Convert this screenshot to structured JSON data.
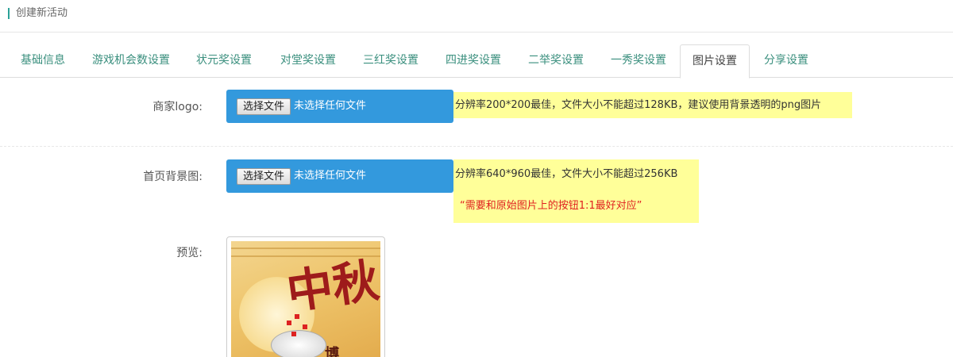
{
  "header": {
    "title": "创建新活动"
  },
  "tabs": [
    {
      "label": "基础信息"
    },
    {
      "label": "游戏机会数设置"
    },
    {
      "label": "状元奖设置"
    },
    {
      "label": "对堂奖设置"
    },
    {
      "label": "三红奖设置"
    },
    {
      "label": "四进奖设置"
    },
    {
      "label": "二举奖设置"
    },
    {
      "label": "一秀奖设置"
    },
    {
      "label": "图片设置"
    },
    {
      "label": "分享设置"
    }
  ],
  "active_tab": "图片设置",
  "form": {
    "logo": {
      "label": "商家logo:",
      "button": "选择文件",
      "status": "未选择任何文件",
      "hint": "分辨率200*200最佳，文件大小不能超过128KB，建议使用背景透明的png图片"
    },
    "background": {
      "label": "首页背景图:",
      "button": "选择文件",
      "status": "未选择任何文件",
      "hint": "分辨率640*960最佳，文件大小不能超过256KB",
      "note": "“需要和原始图片上的按钮1:1最好对应”"
    },
    "preview": {
      "label": "预览:",
      "image_chars": {
        "main": "中秋",
        "sub": "博"
      }
    }
  },
  "colors": {
    "accent": "#2aa198",
    "tab_text": "#3a8f7e",
    "file_box": "#3399dd",
    "hint_bg": "#ffff99",
    "warning_text": "#e02020"
  }
}
